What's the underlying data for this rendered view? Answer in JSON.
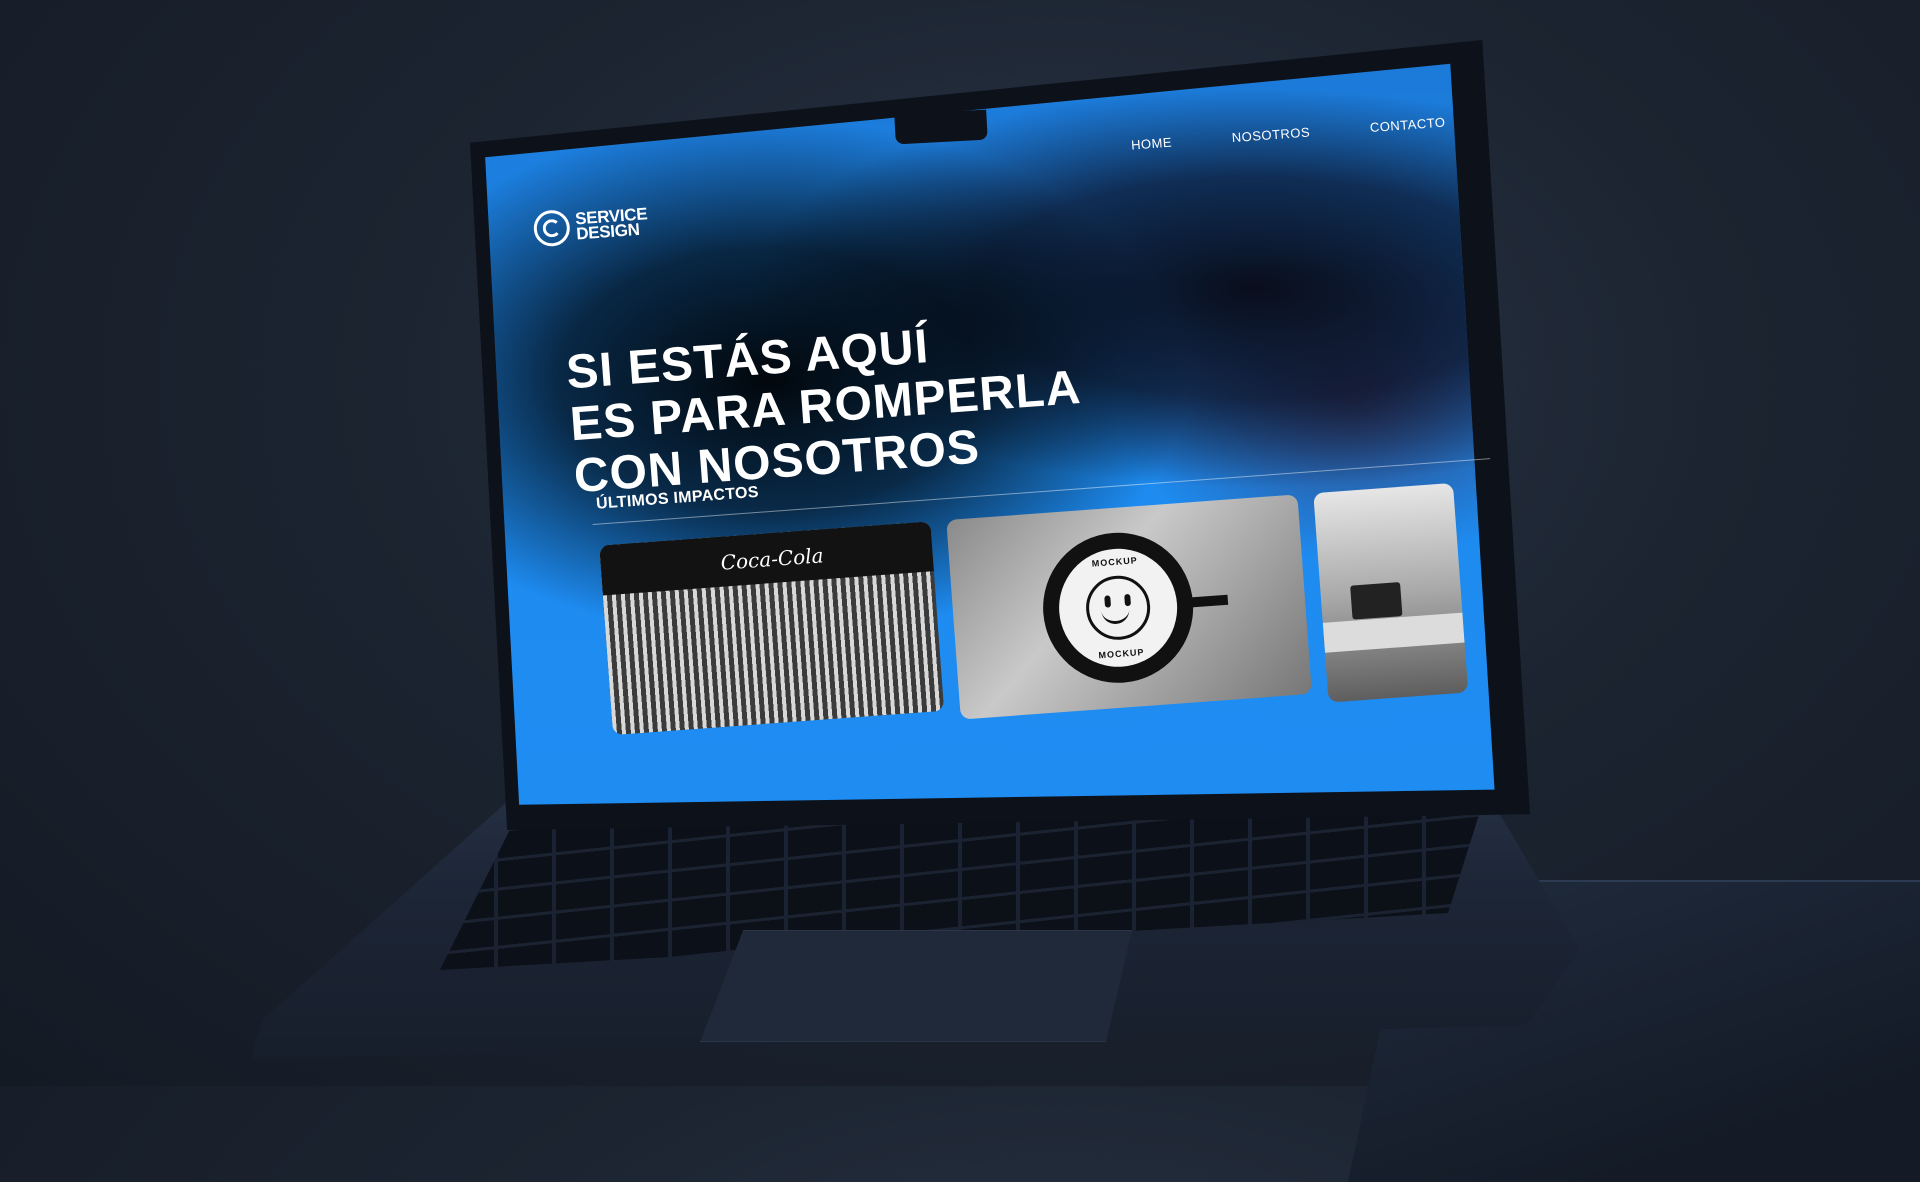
{
  "site": {
    "logo": {
      "line1": "SERVICE",
      "line2": "DESIGN",
      "icon": "service-design-logo-icon"
    },
    "nav": [
      {
        "label": "HOME"
      },
      {
        "label": "NOSOTROS"
      },
      {
        "label": "CONTACTO"
      }
    ],
    "hero": {
      "line1": "SI ESTÁS AQUÍ",
      "line2": "ES PARA ROMPERLA",
      "line3": "CON NOSOTROS"
    },
    "section_title": "ÚLTIMOS IMPACTOS",
    "cards": [
      {
        "brand_text": "Coca-Cola",
        "icon": "fridge-display-image"
      },
      {
        "sign_top": "MOCKUP",
        "sign_bottom": "MOCKUP",
        "icon": "smiley-sign-image"
      },
      {
        "icon": "store-interior-image"
      }
    ]
  },
  "colors": {
    "screen_blue": "#1d8bf0",
    "background": "#1c2431",
    "text": "#ffffff"
  }
}
